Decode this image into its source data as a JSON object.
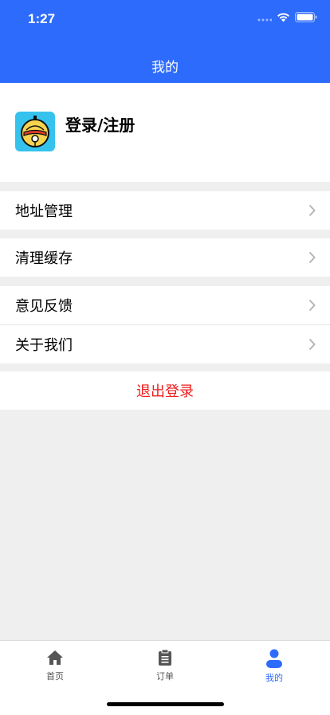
{
  "status_bar": {
    "time": "1:27"
  },
  "header": {
    "title": "我的"
  },
  "profile": {
    "login_label": "登录/注册"
  },
  "menu_groups": [
    {
      "items": [
        {
          "label": "地址管理"
        }
      ]
    },
    {
      "items": [
        {
          "label": "清理缓存"
        }
      ]
    },
    {
      "items": [
        {
          "label": "意见反馈"
        },
        {
          "label": "关于我们"
        }
      ]
    }
  ],
  "logout_label": "退出登录",
  "tabbar": {
    "tabs": [
      {
        "label": "首页",
        "icon": "home-icon",
        "active": false
      },
      {
        "label": "订单",
        "icon": "clipboard-icon",
        "active": false
      },
      {
        "label": "我的",
        "icon": "person-icon",
        "active": true
      }
    ]
  },
  "colors": {
    "primary": "#2d6bfc",
    "logout": "#ee1c1c",
    "background": "#efefef"
  }
}
